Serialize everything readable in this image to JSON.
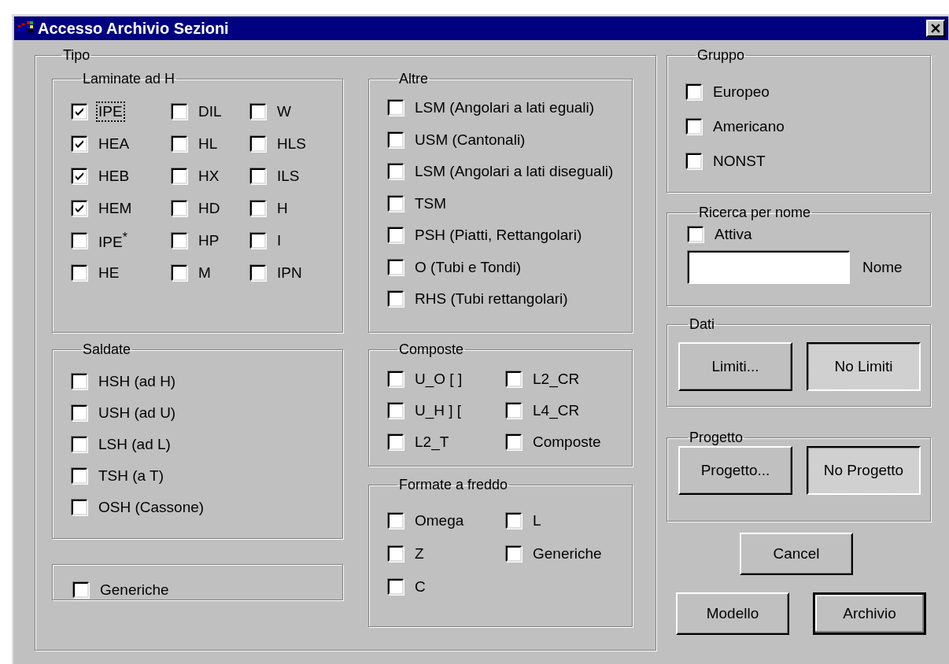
{
  "window": {
    "title": "Accesso Archivio Sezioni"
  },
  "tipo": {
    "legend": "Tipo",
    "laminate": {
      "legend": "Laminate ad H",
      "items": [
        {
          "label": "IPE",
          "checked": true,
          "focused": true
        },
        {
          "label": "DIL",
          "checked": false,
          "focused": false
        },
        {
          "label": "W",
          "checked": false,
          "focused": false
        },
        {
          "label": "HEA",
          "checked": true,
          "focused": false
        },
        {
          "label": "HL",
          "checked": false,
          "focused": false
        },
        {
          "label": "HLS",
          "checked": false,
          "focused": false
        },
        {
          "label": "HEB",
          "checked": true,
          "focused": false
        },
        {
          "label": "HX",
          "checked": false,
          "focused": false
        },
        {
          "label": "ILS",
          "checked": false,
          "focused": false
        },
        {
          "label": "HEM",
          "checked": true,
          "focused": false
        },
        {
          "label": "HD",
          "checked": false,
          "focused": false
        },
        {
          "label": "H",
          "checked": false,
          "focused": false
        },
        {
          "label": "IPE$^{*}$",
          "checked": false,
          "focused": false
        },
        {
          "label": "HP",
          "checked": false,
          "focused": false
        },
        {
          "label": "I",
          "checked": false,
          "focused": false
        },
        {
          "label": "HE",
          "checked": false,
          "focused": false
        },
        {
          "label": "M",
          "checked": false,
          "focused": false
        },
        {
          "label": "IPN",
          "checked": false,
          "focused": false
        }
      ]
    },
    "saldate": {
      "legend": "Saldate",
      "items": [
        {
          "label": "HSH (ad H)",
          "checked": false
        },
        {
          "label": "USH (ad U)",
          "checked": false
        },
        {
          "label": "LSH (ad L)",
          "checked": false
        },
        {
          "label": "TSH (a T)",
          "checked": false
        },
        {
          "label": "OSH (Cassone)",
          "checked": false
        }
      ]
    },
    "generiche": {
      "label": "Generiche",
      "checked": false
    },
    "altre": {
      "legend": "Altre",
      "items": [
        {
          "label": "LSM (Angolari a lati eguali)",
          "checked": false
        },
        {
          "label": "USM (Cantonali)",
          "checked": false
        },
        {
          "label": "LSM (Angolari a lati diseguali)",
          "checked": false
        },
        {
          "label": "TSM",
          "checked": false
        },
        {
          "label": "PSH (Piatti, Rettangolari)",
          "checked": false
        },
        {
          "label": "O (Tubi e Tondi)",
          "checked": false
        },
        {
          "label": "RHS (Tubi rettangolari)",
          "checked": false
        }
      ]
    },
    "composte": {
      "legend": "Composte",
      "items": [
        {
          "label": "U_O [ ]",
          "checked": false
        },
        {
          "label": "L2_CR",
          "checked": false
        },
        {
          "label": "U_H ] [",
          "checked": false
        },
        {
          "label": "L4_CR",
          "checked": false
        },
        {
          "label": "L2_T",
          "checked": false
        },
        {
          "label": "Composte",
          "checked": false
        }
      ]
    },
    "formate": {
      "legend": "Formate a freddo",
      "items": [
        {
          "label": "Omega",
          "checked": false
        },
        {
          "label": "L",
          "checked": false
        },
        {
          "label": "Z",
          "checked": false
        },
        {
          "label": "Generiche",
          "checked": false
        },
        {
          "label": "C",
          "checked": false
        }
      ]
    }
  },
  "gruppo": {
    "legend": "Gruppo",
    "items": [
      {
        "label": "Europeo",
        "checked": false
      },
      {
        "label": "Americano",
        "checked": false
      },
      {
        "label": "NONST",
        "checked": false
      }
    ]
  },
  "ricerca": {
    "legend": "Ricerca per nome",
    "attiva": {
      "label": "Attiva",
      "checked": false
    },
    "nome_label": "Nome"
  },
  "dati": {
    "legend": "Dati",
    "buttons": [
      {
        "label": "Limiti...",
        "pressed": false
      },
      {
        "label": "No Limiti",
        "pressed": true
      }
    ]
  },
  "progetto": {
    "legend": "Progetto",
    "buttons": [
      {
        "label": "Progetto...",
        "pressed": false
      },
      {
        "label": "No Progetto",
        "pressed": true
      }
    ]
  },
  "buttons": [
    {
      "label": "Cancel",
      "default": false
    },
    {
      "label": "Modello",
      "default": false
    },
    {
      "label": "Archivio",
      "default": true
    }
  ]
}
